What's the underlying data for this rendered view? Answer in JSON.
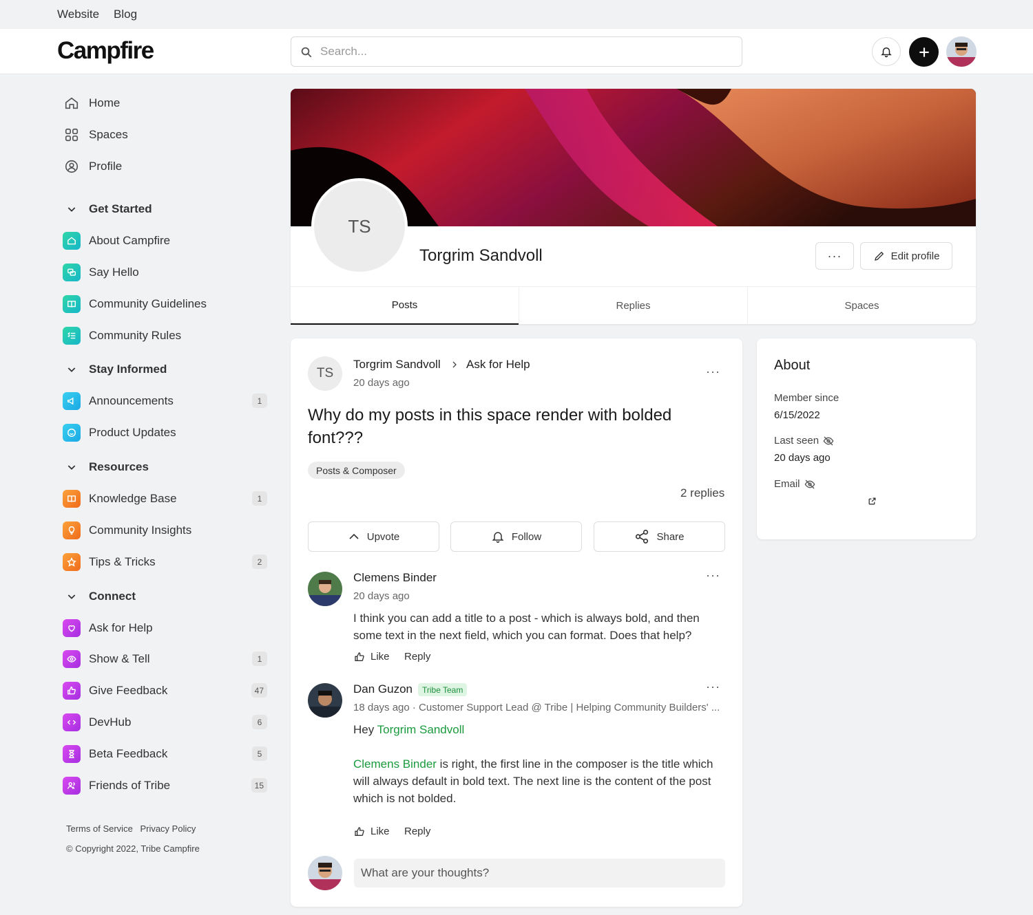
{
  "topbar": {
    "links": [
      "Website",
      "Blog"
    ]
  },
  "header": {
    "logo": "Campfire",
    "search_placeholder": "Search..."
  },
  "sidebar": {
    "main": [
      "Home",
      "Spaces",
      "Profile"
    ],
    "sections": [
      {
        "title": "Get Started",
        "items": [
          {
            "label": "About Campfire",
            "color": "#18c3b0",
            "badge": ""
          },
          {
            "label": "Say Hello",
            "color": "#18c3b0",
            "badge": ""
          },
          {
            "label": "Community Guidelines",
            "color": "#18c3b0",
            "badge": ""
          },
          {
            "label": "Community Rules",
            "color": "#18c3b0",
            "badge": ""
          }
        ]
      },
      {
        "title": "Stay Informed",
        "items": [
          {
            "label": "Announcements",
            "color": "#22b8e6",
            "badge": "1"
          },
          {
            "label": "Product Updates",
            "color": "#22b8e6",
            "badge": ""
          }
        ]
      },
      {
        "title": "Resources",
        "items": [
          {
            "label": "Knowledge Base",
            "color": "#f4841f",
            "badge": "1"
          },
          {
            "label": "Community Insights",
            "color": "#f4841f",
            "badge": ""
          },
          {
            "label": "Tips & Tricks",
            "color": "#f4841f",
            "badge": "2"
          }
        ]
      },
      {
        "title": "Connect",
        "items": [
          {
            "label": "Ask for Help",
            "color": "#c13ce6",
            "badge": ""
          },
          {
            "label": "Show & Tell",
            "color": "#c13ce6",
            "badge": "1"
          },
          {
            "label": "Give Feedback",
            "color": "#c13ce6",
            "badge": "47"
          },
          {
            "label": "DevHub",
            "color": "#c13ce6",
            "badge": "6"
          },
          {
            "label": "Beta Feedback",
            "color": "#c13ce6",
            "badge": "5"
          },
          {
            "label": "Friends of Tribe",
            "color": "#c13ce6",
            "badge": "15"
          }
        ]
      }
    ],
    "footer": {
      "terms": "Terms of Service",
      "privacy": "Privacy Policy",
      "copyright": "© Copyright 2022, Tribe Campfire"
    }
  },
  "profile": {
    "initials": "TS",
    "name": "Torgrim Sandvoll",
    "more_label": "···",
    "edit_label": "Edit profile",
    "tabs": [
      "Posts",
      "Replies",
      "Spaces"
    ]
  },
  "post": {
    "author": "Torgrim Sandvoll",
    "author_initials": "TS",
    "space": "Ask for Help",
    "time": "20 days ago",
    "title_line1": "Why do my posts in this space render with bolded",
    "title_line2": "font???",
    "tag": "Posts & Composer",
    "replies_count": "2 replies",
    "actions": {
      "upvote": "Upvote",
      "follow": "Follow",
      "share": "Share"
    },
    "replies": [
      {
        "author": "Clemens Binder",
        "time": "20 days ago",
        "line1": "I think you can add a title to a post - which is always bold, and then",
        "line2": "some text in the next field, which you can format. Does that help?",
        "like": "Like",
        "reply": "Reply"
      },
      {
        "author": "Dan Guzon",
        "badge": "Tribe Team",
        "meta": "18 days ago · Customer Support Lead @ Tribe | Helping Community Builders' ...",
        "greeting": "Hey ",
        "mention1": "Torgrim Sandvoll",
        "mention2": "Clemens Binder",
        "line1_rest": " is right, the first line in the composer is the title which",
        "line2": "will always default in bold text. The next line is the content of the post",
        "line3": "which is not bolded.",
        "like": "Like",
        "reply": "Reply"
      }
    ],
    "comment_placeholder": "What are your thoughts?"
  },
  "about": {
    "title": "About",
    "member_since_label": "Member since",
    "member_since": "6/15/2022",
    "last_seen_label": "Last seen",
    "last_seen": "20 days ago",
    "email_label": "Email"
  }
}
